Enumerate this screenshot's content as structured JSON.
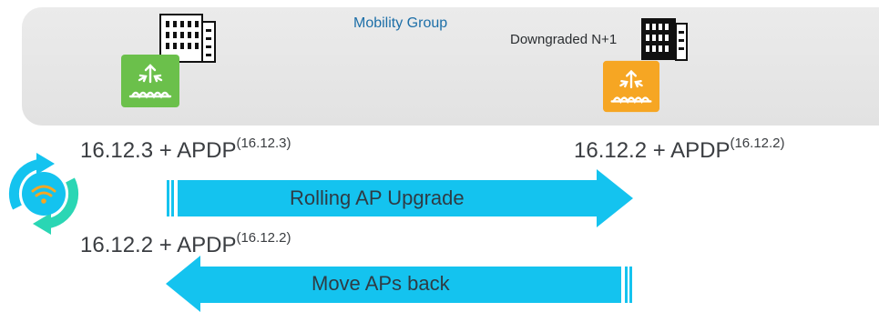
{
  "mobility_group": {
    "title": "Mobility Group"
  },
  "controllers": {
    "primary": {
      "version": "16.12.3",
      "apdp": "16.12.3",
      "color": "#6bc04b"
    },
    "secondary": {
      "label": "Downgraded N+1",
      "version": "16.12.2",
      "apdp": "16.12.2",
      "color": "#f6a623"
    }
  },
  "rows": {
    "after_upgrade": {
      "version": "16.12.2",
      "apdp": "16.12.2"
    }
  },
  "version_joiner": "+ APDP",
  "arrows": {
    "upgrade": {
      "label": "Rolling AP Upgrade",
      "color": "#14c3ef"
    },
    "back": {
      "label": "Move APs back",
      "color": "#14c3ef"
    }
  },
  "icons": {
    "controller": "wireless-controller-icon",
    "building": "building-icon",
    "sync": "sync-wifi-icon"
  },
  "colors": {
    "panel": "#e6e6e6",
    "title": "#1d6fa8",
    "sync_outer": "#14c3ef",
    "sync_inner": "#2ad6b4",
    "wifi": "#f6a623"
  }
}
